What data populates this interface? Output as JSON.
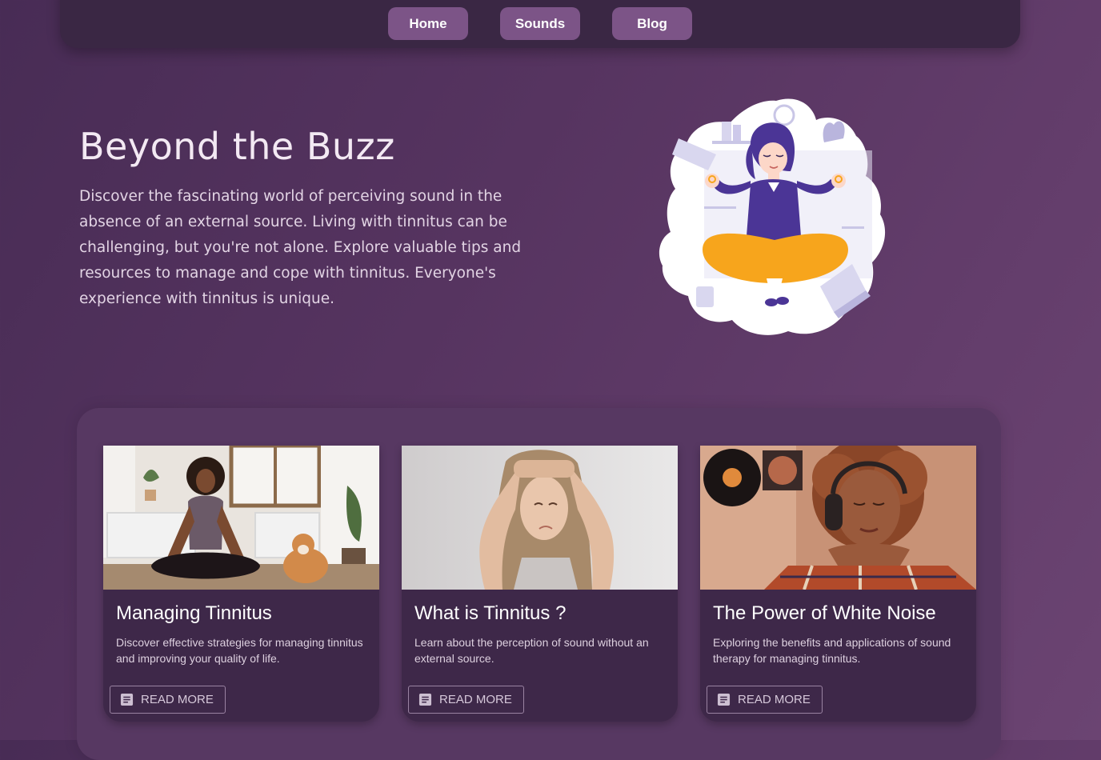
{
  "nav": {
    "items": [
      "Home",
      "Sounds",
      "Blog"
    ]
  },
  "hero": {
    "title": "Beyond the Buzz",
    "text": "Discover the fascinating world of perceiving sound in the absence of an external source. Living with tinnitus can be challenging, but you're not alone. Explore valuable tips and resources to manage and cope with tinnitus. Everyone's experience with tinnitus is unique.",
    "illustration_icon": "meditating-woman-illustration"
  },
  "cards": [
    {
      "title": "Managing Tinnitus",
      "description": "Discover effective strategies for managing tinnitus and improving your quality of life.",
      "button": "READ MORE",
      "image": "woman-meditating-with-dog-photo"
    },
    {
      "title": "What is Tinnitus ?",
      "description": "Learn about the perception of sound without an external source.",
      "button": "READ MORE",
      "image": "woman-holding-head-photo"
    },
    {
      "title": "The Power of White Noise",
      "description": "Exploring the benefits and applications of sound therapy for managing tinnitus.",
      "button": "READ MORE",
      "image": "woman-with-headphones-photo"
    }
  ],
  "colors": {
    "background": "#563460",
    "navbar": "#3a2744",
    "nav_button": "#7c5487",
    "card": "#3e2849",
    "accent_orange": "#f7a51c",
    "accent_indigo": "#4b3596"
  }
}
